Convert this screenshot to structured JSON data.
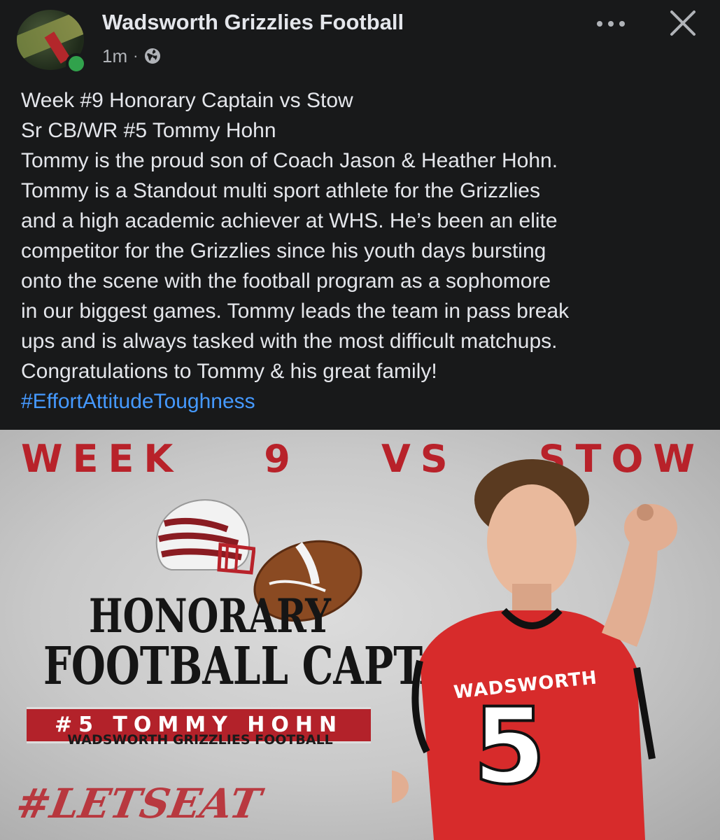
{
  "header": {
    "page_name": "Wadsworth Grizzlies Football",
    "time_ago": "1m",
    "separator": "·",
    "audience_icon": "globe-icon",
    "more_icon": "more-horizontal-icon",
    "close_icon": "close-icon",
    "online_color": "#31a24c"
  },
  "post": {
    "lines": [
      "Week #9 Honorary Captain vs Stow",
      "Sr CB/WR #5 Tommy Hohn",
      "Tommy is the proud son of Coach Jason & Heather Hohn.",
      "Tommy is a Standout multi sport athlete for the Grizzlies",
      "and a high academic achiever at WHS. He’s been an elite",
      "competitor for the Grizzlies since his youth days bursting",
      "onto the scene with the football program as a sophomore",
      "in our biggest games. Tommy leads the team in pass break",
      "ups and is always tasked with the most difficult matchups.",
      "Congratulations to Tommy & his great family!"
    ],
    "hashtag": "#EffortAttitudeToughness",
    "link_color": "#4599ff"
  },
  "graphic": {
    "banner_words": [
      "WEEK",
      "9",
      "VS",
      "STOW"
    ],
    "title_line1": "HONORARY",
    "title_line2": "FOOTBALL CAPTAIN",
    "player_label": "#5 TOMMY HOHN",
    "program": "WADSWORTH GRIZZLIES FOOTBALL",
    "slogan": "#LETSEAT",
    "jersey_name": "WADSWORTH",
    "jersey_number": "5",
    "accent_color": "#b8222a"
  }
}
